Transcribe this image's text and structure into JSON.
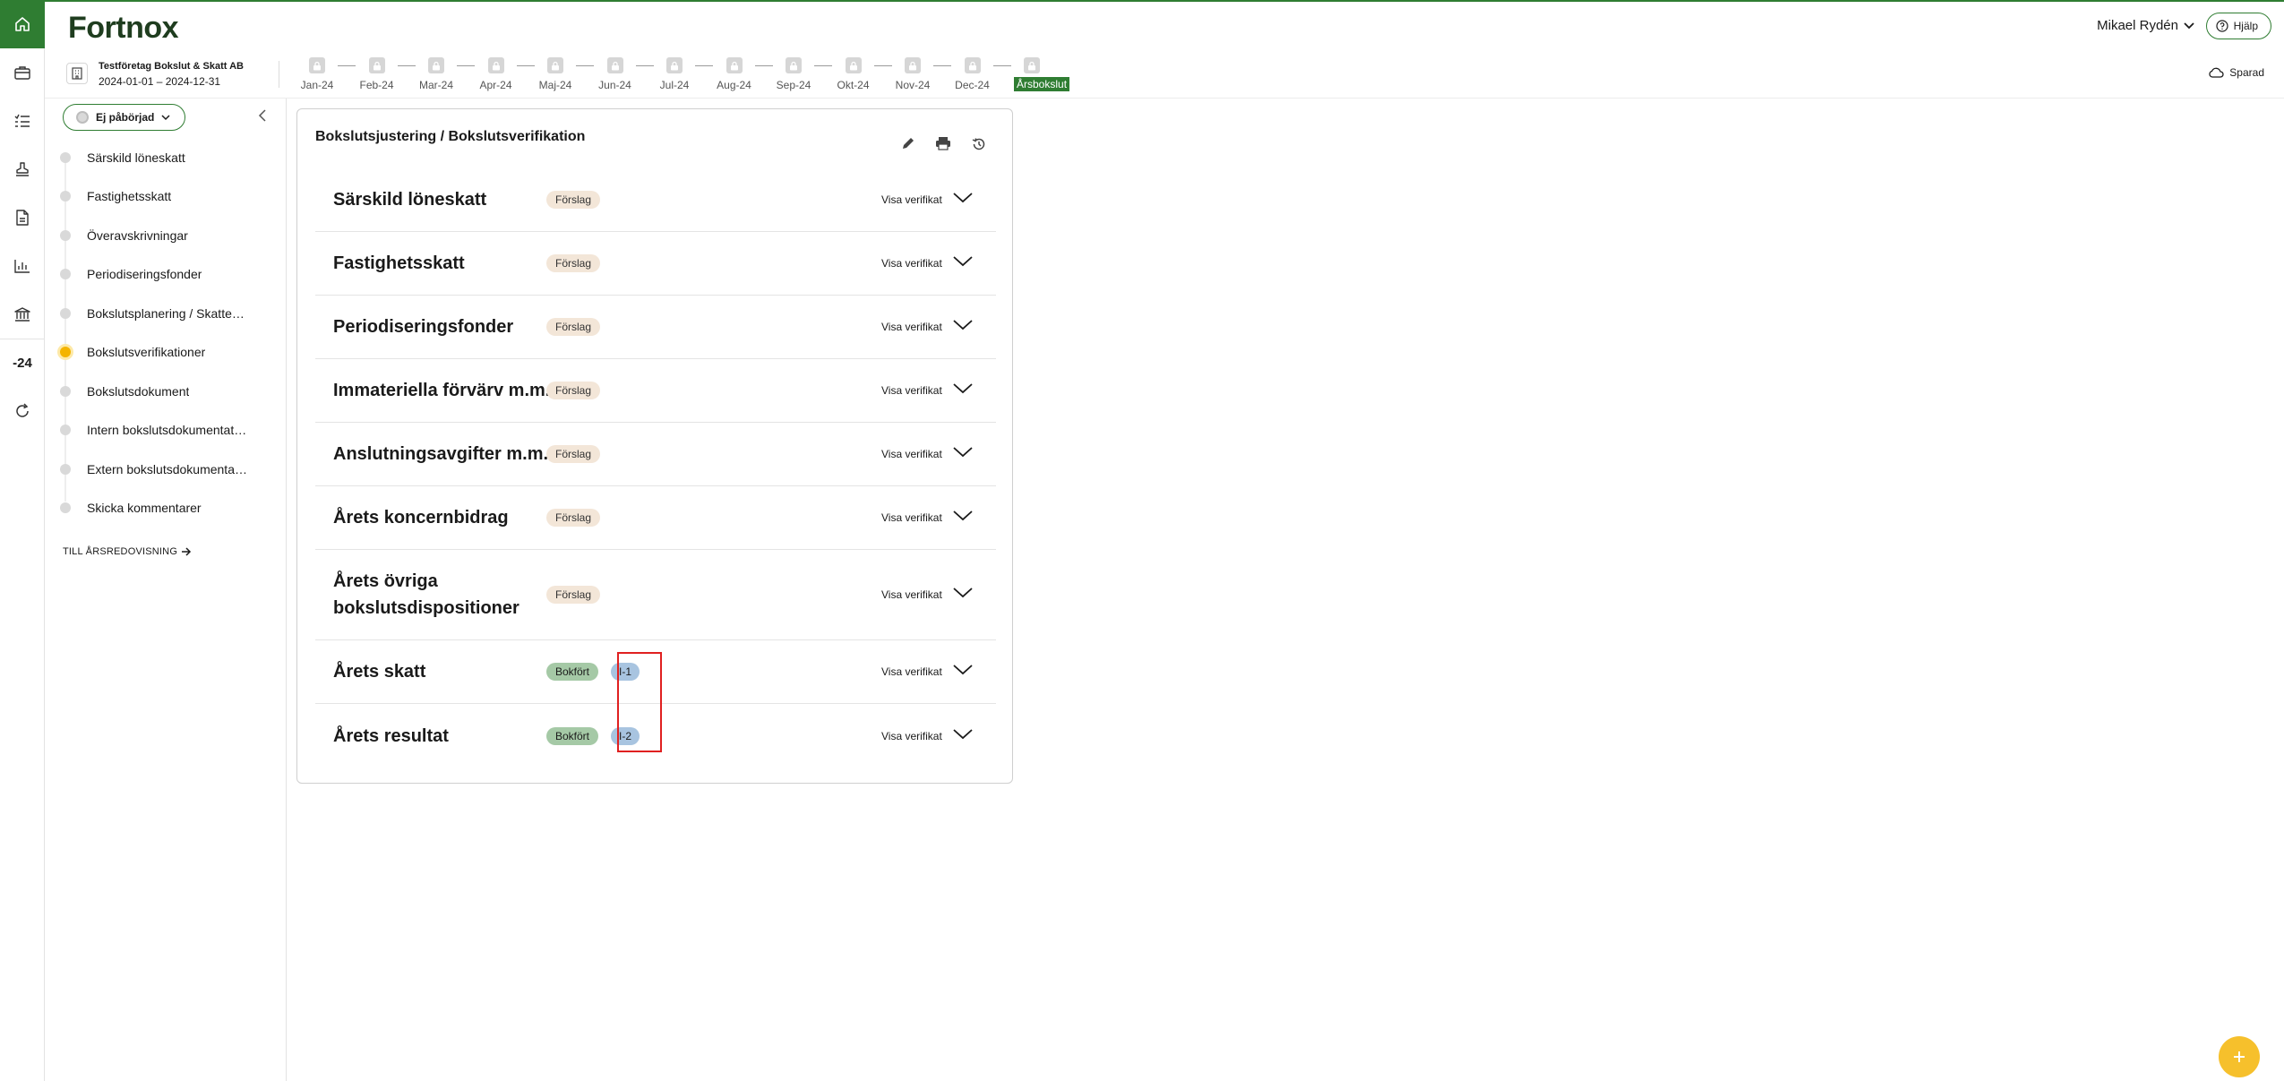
{
  "app": {
    "logo": "Fortnox"
  },
  "rail": {
    "year_label": "-24"
  },
  "header": {
    "user_name": "Mikael Rydén",
    "help_label": "Hjälp"
  },
  "company": {
    "name": "Testföretag Bokslut & Skatt AB",
    "period": "2024-01-01 – 2024-12-31"
  },
  "periods": [
    "Jan-24",
    "Feb-24",
    "Mar-24",
    "Apr-24",
    "Maj-24",
    "Jun-24",
    "Jul-24",
    "Aug-24",
    "Sep-24",
    "Okt-24",
    "Nov-24",
    "Dec-24",
    "Årsbokslut"
  ],
  "saved_label": "Sparad",
  "sidebar": {
    "status_label": "Ej påbörjad",
    "steps": [
      "Särskild löneskatt",
      "Fastighetsskatt",
      "Överavskrivningar",
      "Periodiseringsfonder",
      "Bokslutsplanering / Skatteberäkning",
      "Bokslutsverifikationer",
      "Bokslutsdokument",
      "Intern bokslutsdokumentation",
      "Extern bokslutsdokumentation",
      "Skicka kommentarer"
    ],
    "active_step": "Bokslutsverifikationer",
    "to_annual_label": "TILL ÅRSREDOVISNING"
  },
  "card": {
    "title": "Bokslutsjustering / Bokslutsverifikation",
    "rows": [
      {
        "title": "Särskild löneskatt",
        "status": "Förslag",
        "link": "Visa verifikat"
      },
      {
        "title": "Fastighetsskatt",
        "status": "Förslag",
        "link": "Visa verifikat"
      },
      {
        "title": "Periodiseringsfonder",
        "status": "Förslag",
        "link": "Visa verifikat"
      },
      {
        "title": "Immateriella förvärv m.m.",
        "status": "Förslag",
        "link": "Visa verifikat"
      },
      {
        "title": "Anslutningsavgifter m.m.",
        "status": "Förslag",
        "link": "Visa verifikat"
      },
      {
        "title": "Årets koncernbidrag",
        "status": "Förslag",
        "link": "Visa verifikat"
      },
      {
        "title": "Årets övriga bokslutsdispositioner",
        "status": "Förslag",
        "link": "Visa verifikat"
      },
      {
        "title": "Årets skatt",
        "status": "Bokfört",
        "voucher": "I-1",
        "link": "Visa verifikat"
      },
      {
        "title": "Årets resultat",
        "status": "Bokfört",
        "voucher": "I-2",
        "link": "Visa verifikat"
      }
    ]
  },
  "colors": {
    "brand_green": "#2f7d32",
    "active_step": "#f4b400",
    "fab": "#f6c02c",
    "highlight": "#e02020"
  }
}
